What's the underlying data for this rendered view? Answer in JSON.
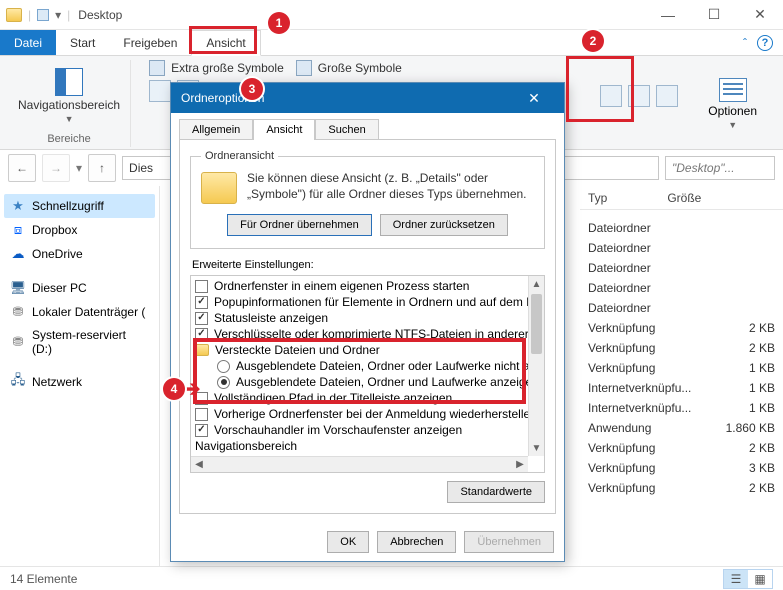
{
  "window": {
    "title": "Desktop"
  },
  "ribbon": {
    "tabs": {
      "file": "Datei",
      "start": "Start",
      "share": "Freigeben",
      "view": "Ansicht"
    },
    "groups": {
      "panes_label": "Bereiche",
      "navpane": "Navigationsbereich",
      "layout_extra": "Extra große Symbole",
      "layout_large": "Große Symbole",
      "options": "Optionen"
    }
  },
  "nav": {
    "address": "Dies",
    "search_placeholder": "\"Desktop\"..."
  },
  "sidebar": {
    "items": [
      {
        "label": "Schnellzugriff"
      },
      {
        "label": "Dropbox"
      },
      {
        "label": "OneDrive"
      },
      {
        "label": "Dieser PC"
      },
      {
        "label": "Lokaler Datenträger ("
      },
      {
        "label": "System-reserviert (D:)"
      },
      {
        "label": "Netzwerk"
      }
    ]
  },
  "columns": {
    "type": "Typ",
    "size": "Größe"
  },
  "rows": [
    {
      "type": "Dateiordner",
      "size": ""
    },
    {
      "type": "Dateiordner",
      "size": ""
    },
    {
      "type": "Dateiordner",
      "size": ""
    },
    {
      "type": "Dateiordner",
      "size": ""
    },
    {
      "type": "Dateiordner",
      "size": ""
    },
    {
      "type": "Verknüpfung",
      "size": "2 KB"
    },
    {
      "type": "Verknüpfung",
      "size": "2 KB"
    },
    {
      "type": "Verknüpfung",
      "size": "1 KB"
    },
    {
      "type": "Internetverknüpfu...",
      "size": "1 KB"
    },
    {
      "type": "Internetverknüpfu...",
      "size": "1 KB"
    },
    {
      "type": "Anwendung",
      "size": "1.860 KB"
    },
    {
      "type": "Verknüpfung",
      "size": "2 KB"
    },
    {
      "type": "Verknüpfung",
      "size": "3 KB"
    },
    {
      "type": "Verknüpfung",
      "size": "2 KB"
    }
  ],
  "status": {
    "count": "14 Elemente"
  },
  "dialog": {
    "title": "Ordneroptionen",
    "tabs": {
      "general": "Allgemein",
      "view": "Ansicht",
      "search": "Suchen"
    },
    "folderview": {
      "legend": "Ordneransicht",
      "text1": "Sie können diese Ansicht (z. B. „Details\" oder",
      "text2": "„Symbole\") für alle Ordner dieses Typs übernehmen.",
      "apply": "Für Ordner übernehmen",
      "reset": "Ordner zurücksetzen"
    },
    "advanced": {
      "label": "Erweiterte Einstellungen:",
      "items": {
        "own_process": "Ordnerfenster in einem eigenen Prozess starten",
        "popup_info": "Popupinformationen für Elemente in Ordnern und auf dem Desk",
        "statusbar": "Statusleiste anzeigen",
        "ntfs_truncated": "Verschlüsselte oder komprimierte NTFS-Dateien in anderer Fa",
        "hidden_header": "Versteckte Dateien und Ordner",
        "radio_hide": "Ausgeblendete Dateien, Ordner oder Laufwerke nicht an",
        "radio_show": "Ausgeblendete Dateien, Ordner und Laufwerke anzeiger",
        "path_titlebar_truncated": "Vollständigen Pfad in der Titelleiste anzeigen",
        "restore_prev": "Vorherige Ordnerfenster bei der Anmeldung wiederherstellen",
        "preview_handler": "Vorschauhandler im Vorschaufenster anzeigen",
        "nav_area": "Navigationsbereich"
      },
      "defaults": "Standardwerte"
    },
    "footer": {
      "ok": "OK",
      "cancel": "Abbrechen",
      "apply": "Übernehmen"
    }
  },
  "annotations": {
    "n1": "1",
    "n2": "2",
    "n3": "3",
    "n4": "4"
  }
}
